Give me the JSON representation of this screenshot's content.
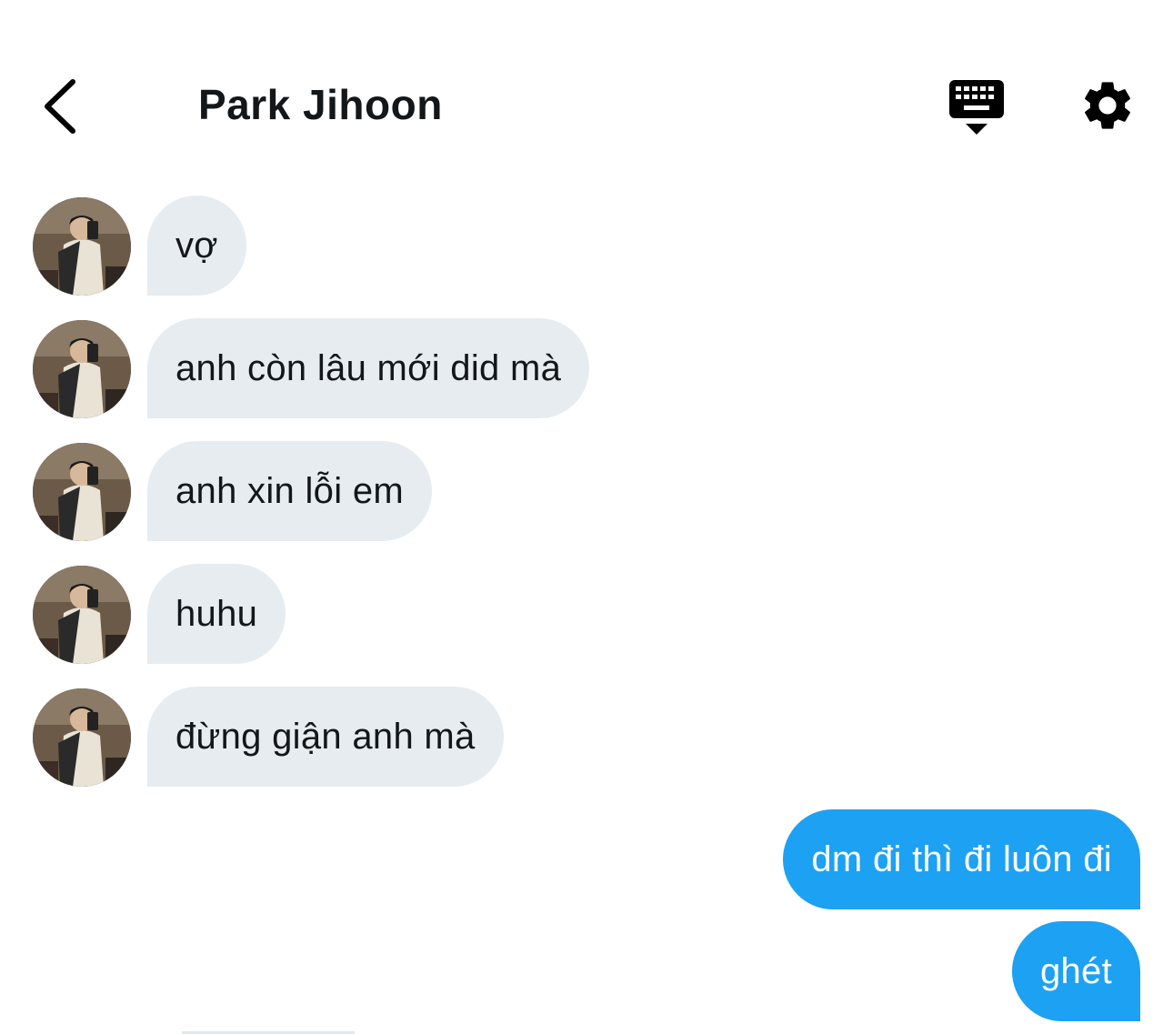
{
  "header": {
    "title": "Park Jihoon",
    "back_icon": "chevron-left-icon",
    "keyboard_icon": "keyboard-hide-icon",
    "settings_icon": "gear-icon"
  },
  "messages": [
    {
      "sender": "received",
      "text": "vợ"
    },
    {
      "sender": "received",
      "text": "anh còn lâu mới did mà"
    },
    {
      "sender": "received",
      "text": "anh xin lỗi em"
    },
    {
      "sender": "received",
      "text": "huhu"
    },
    {
      "sender": "received",
      "text": "đừng giận anh mà"
    },
    {
      "sender": "sent",
      "text": "dm đi thì đi luôn đi"
    },
    {
      "sender": "sent",
      "text": "ghét"
    }
  ],
  "colors": {
    "received_bubble": "#e6ecf0",
    "sent_bubble": "#1da1f2",
    "text": "#14171a"
  }
}
